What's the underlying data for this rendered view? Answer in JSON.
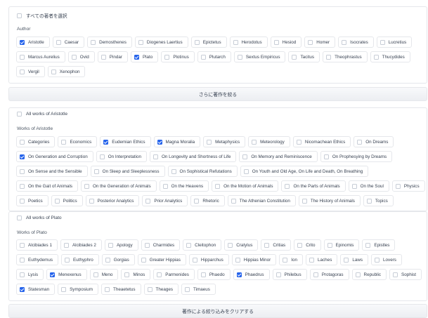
{
  "select_all_authors": "すべての著者を選択",
  "author_section": {
    "label": "Author",
    "rows": [
      [
        {
          "label": "Aristotle",
          "checked": true
        },
        {
          "label": "Caesar",
          "checked": false
        },
        {
          "label": "Demosthenes",
          "checked": false
        },
        {
          "label": "Diogenes Laertius",
          "checked": false
        },
        {
          "label": "Epictetus",
          "checked": false
        },
        {
          "label": "Herodotus",
          "checked": false
        },
        {
          "label": "Hesiod",
          "checked": false
        },
        {
          "label": "Homer",
          "checked": false
        },
        {
          "label": "Isocrates",
          "checked": false
        },
        {
          "label": "Lucretius",
          "checked": false
        }
      ],
      [
        {
          "label": "Marcus Aurelius",
          "checked": false
        },
        {
          "label": "Ovid",
          "checked": false
        },
        {
          "label": "Pindar",
          "checked": false
        },
        {
          "label": "Plato",
          "checked": true
        },
        {
          "label": "Plotinus",
          "checked": false
        },
        {
          "label": "Plutarch",
          "checked": false
        },
        {
          "label": "Sextus Empiricus",
          "checked": false
        },
        {
          "label": "Tacitus",
          "checked": false
        },
        {
          "label": "Theophrastus",
          "checked": false
        },
        {
          "label": "Thucydides",
          "checked": false
        }
      ],
      [
        {
          "label": "Vergil",
          "checked": false
        },
        {
          "label": "Xenophon",
          "checked": false
        }
      ]
    ]
  },
  "narrow_button": "さらに著作を絞る",
  "aristotle_works": {
    "select_all": "All works of Aristotle",
    "label": "Works of Aristotle",
    "rows": [
      [
        {
          "label": "Categories",
          "checked": false
        },
        {
          "label": "Economics",
          "checked": false
        },
        {
          "label": "Eudemian Ethics",
          "checked": true
        },
        {
          "label": "Magna Moralia",
          "checked": true
        },
        {
          "label": "Metaphysics",
          "checked": false
        },
        {
          "label": "Meteorology",
          "checked": false
        },
        {
          "label": "Nicomachean Ethics",
          "checked": false
        },
        {
          "label": "On Dreams",
          "checked": false
        }
      ],
      [
        {
          "label": "On Generation and Corruption",
          "checked": true
        },
        {
          "label": "On Interpretation",
          "checked": false
        },
        {
          "label": "On Longevity and Shortness of Life",
          "checked": false
        },
        {
          "label": "On Memory and Reminiscence",
          "checked": false
        },
        {
          "label": "On Prophesying by Dreams",
          "checked": false
        }
      ],
      [
        {
          "label": "On Sense and the Sensible",
          "checked": false
        },
        {
          "label": "On Sleep and Sleeplessness",
          "checked": false
        },
        {
          "label": "On Sophistical Refutations",
          "checked": false
        },
        {
          "label": "On Youth and Old Age, On Life and Death, On Breathing",
          "checked": false
        }
      ],
      [
        {
          "label": "On the Gait of Animals",
          "checked": false
        },
        {
          "label": "On the Generation of Animals",
          "checked": false
        },
        {
          "label": "On the Heavens",
          "checked": false
        },
        {
          "label": "On the Motion of Animals",
          "checked": false
        },
        {
          "label": "On the Parts of Animals",
          "checked": false
        },
        {
          "label": "On the Soul",
          "checked": false
        },
        {
          "label": "Physics",
          "checked": false
        }
      ],
      [
        {
          "label": "Poetics",
          "checked": false
        },
        {
          "label": "Politics",
          "checked": false
        },
        {
          "label": "Posterior Analytics",
          "checked": false
        },
        {
          "label": "Prior Analytics",
          "checked": false
        },
        {
          "label": "Rhetoric",
          "checked": false
        },
        {
          "label": "The Athenian Constitution",
          "checked": false
        },
        {
          "label": "The History of Animals",
          "checked": false
        },
        {
          "label": "Topics",
          "checked": false
        }
      ]
    ]
  },
  "plato_works": {
    "select_all": "All works of Plato",
    "label": "Works of Plato",
    "rows": [
      [
        {
          "label": "Alcibiades 1",
          "checked": false
        },
        {
          "label": "Alcibiades 2",
          "checked": false
        },
        {
          "label": "Apology",
          "checked": false
        },
        {
          "label": "Charmides",
          "checked": false
        },
        {
          "label": "Cleitophon",
          "checked": false
        },
        {
          "label": "Cratylus",
          "checked": false
        },
        {
          "label": "Critias",
          "checked": false
        },
        {
          "label": "Crito",
          "checked": false
        },
        {
          "label": "Epinomis",
          "checked": false
        },
        {
          "label": "Epistles",
          "checked": false
        }
      ],
      [
        {
          "label": "Euthydemus",
          "checked": false
        },
        {
          "label": "Euthyphro",
          "checked": false
        },
        {
          "label": "Gorgias",
          "checked": false
        },
        {
          "label": "Greater Hippias",
          "checked": false
        },
        {
          "label": "Hipparchus",
          "checked": false
        },
        {
          "label": "Hippias Minor",
          "checked": false
        },
        {
          "label": "Ion",
          "checked": false
        },
        {
          "label": "Laches",
          "checked": false
        },
        {
          "label": "Laws",
          "checked": false
        },
        {
          "label": "Lovers",
          "checked": false
        }
      ],
      [
        {
          "label": "Lysis",
          "checked": false
        },
        {
          "label": "Menexenus",
          "checked": true
        },
        {
          "label": "Meno",
          "checked": false
        },
        {
          "label": "Minos",
          "checked": false
        },
        {
          "label": "Parmenides",
          "checked": false
        },
        {
          "label": "Phaedo",
          "checked": false
        },
        {
          "label": "Phaedrus",
          "checked": true
        },
        {
          "label": "Philebus",
          "checked": false
        },
        {
          "label": "Protagoras",
          "checked": false
        },
        {
          "label": "Republic",
          "checked": false
        },
        {
          "label": "Sophist",
          "checked": false
        }
      ],
      [
        {
          "label": "Statesman",
          "checked": true
        },
        {
          "label": "Symposium",
          "checked": false
        },
        {
          "label": "Theaetetus",
          "checked": false
        },
        {
          "label": "Theages",
          "checked": false
        },
        {
          "label": "Timaeus",
          "checked": false
        }
      ]
    ]
  },
  "clear_button": "著作による絞り込みをクリアする",
  "colors": {
    "accent": "#2563eb",
    "border": "#e5e7eb",
    "text": "#374151"
  }
}
